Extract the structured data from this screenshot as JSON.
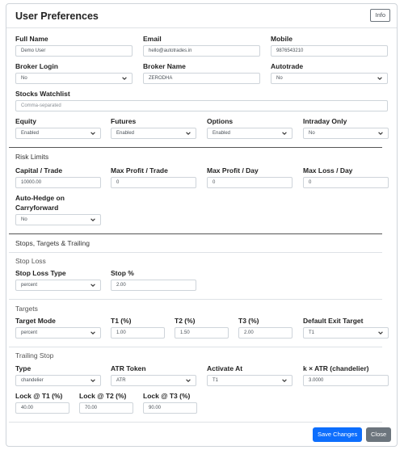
{
  "header": {
    "title": "User Preferences",
    "info_label": "Info"
  },
  "profile": {
    "full_name_label": "Full Name",
    "full_name_value": "Demo User",
    "email_label": "Email",
    "email_value": "hello@autotrades.in",
    "mobile_label": "Mobile",
    "mobile_value": "9876543210",
    "broker_login_label": "Broker Login",
    "broker_login_value": "No",
    "broker_name_label": "Broker Name",
    "broker_name_value": "ZERODHA",
    "autotrade_label": "Autotrade",
    "autotrade_value": "No",
    "watchlist_label": "Stocks Watchlist",
    "watchlist_placeholder": "Comma-separated",
    "equity_label": "Equity",
    "equity_value": "Enabled",
    "futures_label": "Futures",
    "futures_value": "Enabled",
    "options_label": "Options",
    "options_value": "Enabled",
    "intraday_label": "Intraday Only",
    "intraday_value": "No"
  },
  "risk": {
    "section_title": "Risk Limits",
    "capital_label": "Capital / Trade",
    "capital_value": "10000.00",
    "max_profit_trade_label": "Max Profit / Trade",
    "max_profit_trade_value": "0",
    "max_profit_day_label": "Max Profit / Day",
    "max_profit_day_value": "0",
    "max_loss_day_label": "Max Loss / Day",
    "max_loss_day_value": "0",
    "autohedge_label_1": "Auto-Hedge on",
    "autohedge_label_2": "Carryforward",
    "autohedge_value": "No"
  },
  "stops": {
    "section_title": "Stops, Targets & Trailing",
    "stop_loss_heading": "Stop Loss",
    "sl_type_label": "Stop Loss Type",
    "sl_type_value": "percent",
    "stop_pct_label": "Stop %",
    "stop_pct_value": "2.00",
    "targets_heading": "Targets",
    "target_mode_label": "Target Mode",
    "target_mode_value": "percent",
    "t1_label": "T1 (%)",
    "t1_value": "1.00",
    "t2_label": "T2 (%)",
    "t2_value": "1.50",
    "t3_label": "T3 (%)",
    "t3_value": "2.00",
    "exit_target_label": "Default Exit Target",
    "exit_target_value": "T1",
    "trailing_heading": "Trailing Stop",
    "type_label": "Type",
    "type_value": "chandelier",
    "atr_token_label": "ATR Token",
    "atr_token_value": "ATR",
    "activate_label": "Activate At",
    "activate_value": "T1",
    "k_atr_label": "k × ATR (chandelier)",
    "k_atr_value": "3.0000",
    "lock_t1_label": "Lock @ T1 (%)",
    "lock_t1_value": "40.00",
    "lock_t2_label": "Lock @ T2 (%)",
    "lock_t2_value": "70.00",
    "lock_t3_label": "Lock @ T3 (%)",
    "lock_t3_value": "90.00"
  },
  "footer": {
    "save_label": "Save Changes",
    "close_label": "Close"
  },
  "colors": {
    "primary": "#0d6efd",
    "secondary": "#6c757d",
    "border": "#ced4da"
  }
}
